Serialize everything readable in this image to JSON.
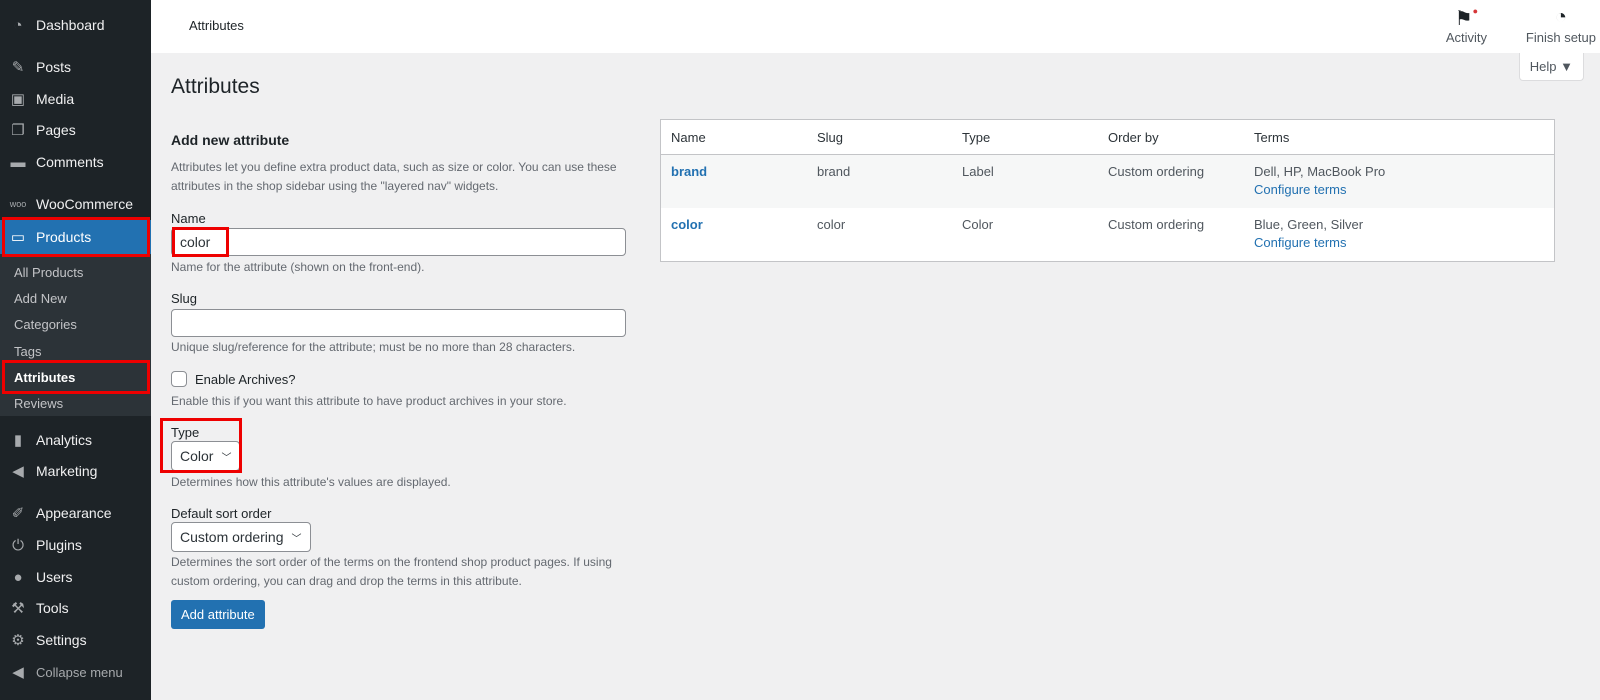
{
  "sidebar": {
    "items": [
      {
        "label": "Dashboard",
        "icon": "dashboard-icon"
      },
      {
        "label": "Posts",
        "icon": "pin-icon"
      },
      {
        "label": "Media",
        "icon": "media-icon"
      },
      {
        "label": "Pages",
        "icon": "pages-icon"
      },
      {
        "label": "Comments",
        "icon": "comment-icon"
      },
      {
        "label": "WooCommerce",
        "icon": "woo-icon"
      },
      {
        "label": "Products",
        "icon": "archive-icon"
      },
      {
        "label": "Analytics",
        "icon": "bar-chart-icon"
      },
      {
        "label": "Marketing",
        "icon": "megaphone-icon"
      },
      {
        "label": "Appearance",
        "icon": "brush-icon"
      },
      {
        "label": "Plugins",
        "icon": "plug-icon"
      },
      {
        "label": "Users",
        "icon": "user-icon"
      },
      {
        "label": "Tools",
        "icon": "wrench-icon"
      },
      {
        "label": "Settings",
        "icon": "settings-icon"
      },
      {
        "label": "Collapse menu",
        "icon": "collapse-icon"
      }
    ],
    "submenu": [
      "All Products",
      "Add New",
      "Categories",
      "Tags",
      "Attributes",
      "Reviews"
    ]
  },
  "topbar": {
    "title": "Attributes",
    "activity": "Activity",
    "finish_setup": "Finish setup",
    "help": "Help ▼"
  },
  "page": {
    "title": "Attributes"
  },
  "form": {
    "heading": "Add new attribute",
    "intro": "Attributes let you define extra product data, such as size or color. You can use these attributes in the shop sidebar using the \"layered nav\" widgets.",
    "name_label": "Name",
    "name_value": "color",
    "name_help": "Name for the attribute (shown on the front-end).",
    "slug_label": "Slug",
    "slug_value": "",
    "slug_help": "Unique slug/reference for the attribute; must be no more than 28 characters.",
    "archives_label": "Enable Archives?",
    "archives_checked": false,
    "archives_help": "Enable this if you want this attribute to have product archives in your store.",
    "type_label": "Type",
    "type_value": "Color",
    "type_help": "Determines how this attribute's values are displayed.",
    "sort_label": "Default sort order",
    "sort_value": "Custom ordering",
    "sort_help": "Determines the sort order of the terms on the frontend shop product pages. If using custom ordering, you can drag and drop the terms in this attribute.",
    "submit": "Add attribute"
  },
  "table": {
    "headers": [
      "Name",
      "Slug",
      "Type",
      "Order by",
      "Terms"
    ],
    "rows": [
      {
        "name": "brand",
        "slug": "brand",
        "type": "Label",
        "order": "Custom ordering",
        "terms": "Dell, HP, MacBook Pro",
        "configure": "Configure terms"
      },
      {
        "name": "color",
        "slug": "color",
        "type": "Color",
        "order": "Custom ordering",
        "terms": "Blue, Green, Silver",
        "configure": "Configure terms"
      }
    ]
  },
  "colors": {
    "accent": "#2271b1",
    "sidebar": "#1d2327",
    "highlight": "#e00000"
  }
}
